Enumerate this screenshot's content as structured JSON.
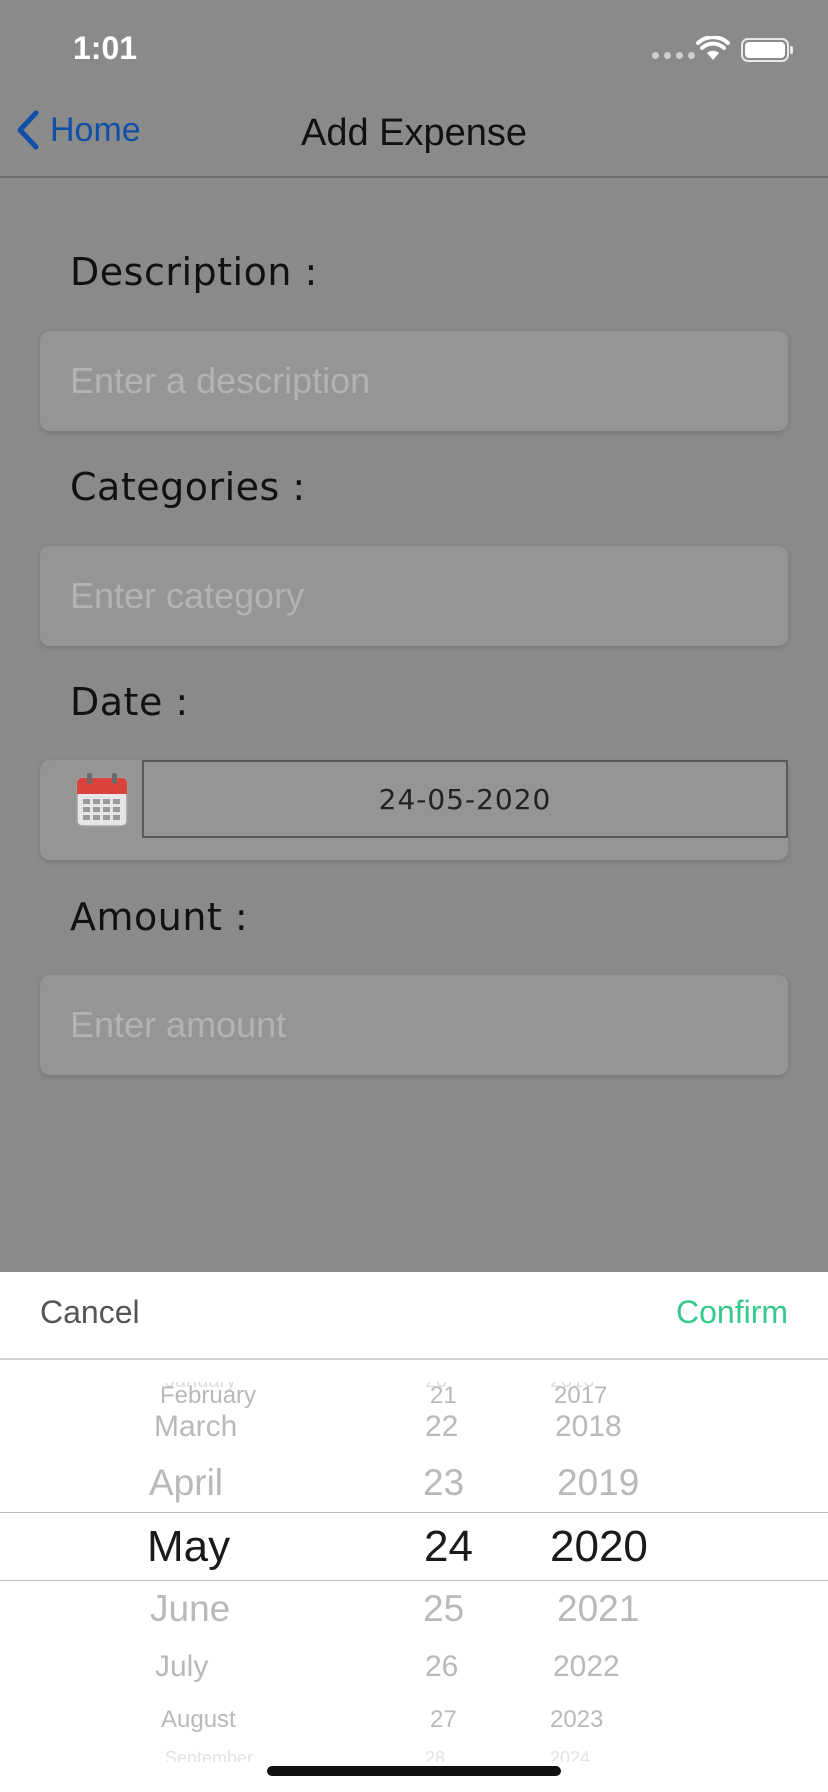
{
  "status_bar": {
    "time": "1:01"
  },
  "nav": {
    "back_label": "Home",
    "title": "Add Expense"
  },
  "form": {
    "description_label": "Description :",
    "description_placeholder": "Enter a description",
    "categories_label": "Categories :",
    "categories_placeholder": "Enter category",
    "date_label": "Date :",
    "date_value": "24-05-2020",
    "amount_label": "Amount :",
    "amount_placeholder": "Enter amount"
  },
  "picker": {
    "cancel_label": "Cancel",
    "confirm_label": "Confirm",
    "confirm_color": "#35c98f",
    "months": [
      "February",
      "March",
      "April",
      "May",
      "June",
      "July",
      "August"
    ],
    "days": [
      "21",
      "22",
      "23",
      "24",
      "25",
      "26",
      "27"
    ],
    "years": [
      "2017",
      "2018",
      "2019",
      "2020",
      "2021",
      "2022",
      "2023"
    ],
    "selected": {
      "month": "May",
      "day": "24",
      "year": "2020"
    }
  }
}
